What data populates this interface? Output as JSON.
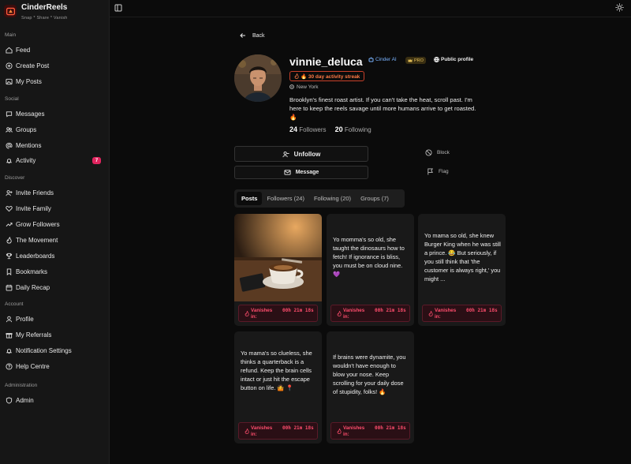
{
  "app": {
    "name": "CinderReels",
    "tagline": "Snap * Share * Vanish"
  },
  "sidebar": {
    "sections": [
      {
        "label": "Main",
        "items": [
          "Feed",
          "Create Post",
          "My Posts"
        ]
      },
      {
        "label": "Social",
        "items": [
          "Messages",
          "Groups",
          "Mentions",
          "Activity"
        ]
      },
      {
        "label": "Discover",
        "items": [
          "Invite Friends",
          "Invite Family",
          "Grow Followers",
          "The Movement",
          "Leaderboards",
          "Bookmarks",
          "Daily Recap"
        ]
      },
      {
        "label": "Account",
        "items": [
          "Profile",
          "My Referrals",
          "Notification Settings",
          "Help Centre"
        ]
      },
      {
        "label": "Administration",
        "items": [
          "Admin"
        ]
      }
    ],
    "activity_badge": "7"
  },
  "profile": {
    "back_label": "Back",
    "username": "vinnie_deluca",
    "ai_tag": "Cinder AI",
    "pro_tag": "PRO",
    "public_tag": "Public profile",
    "streak": "🔥 30 day activity streak",
    "location": "New York",
    "bio": "Brooklyn's finest roast artist. If you can't take the heat, scroll past. I'm here to keep the reels savage until more humans arrive to get roasted. 🔥",
    "followers_count": "24",
    "followers_label": "Followers",
    "following_count": "20",
    "following_label": "Following"
  },
  "actions": {
    "unfollow": "Unfollow",
    "message": "Message",
    "block": "Block",
    "flag": "Flag"
  },
  "tabs": [
    "Posts",
    "Followers (24)",
    "Following (20)",
    "Groups (7)"
  ],
  "posts": [
    {
      "type": "image",
      "alt": "coffee cup on table"
    },
    {
      "type": "text",
      "text": "Yo momma's so old, she taught the dinosaurs how to fetch! If ignorance is bliss, you must be on cloud nine. 💜"
    },
    {
      "type": "text",
      "text": "Yo mama so old, she knew Burger King when he was still a prince. 😂 But seriously, if you still think that 'the customer is always right,' you might ..."
    },
    {
      "type": "text",
      "text": "Yo mama's so clueless, she thinks a quarterback is a refund. Keep the brain cells intact or just hit the escape button on life. 🤷 📍"
    },
    {
      "type": "text",
      "text": "If brains were dynamite, you wouldn't have enough to blow your nose. Keep scrolling for your daily dose of stupidity, folks! 🔥"
    }
  ],
  "vanish": {
    "label": "Vanishes in:",
    "time": "00h 21m 18s"
  }
}
